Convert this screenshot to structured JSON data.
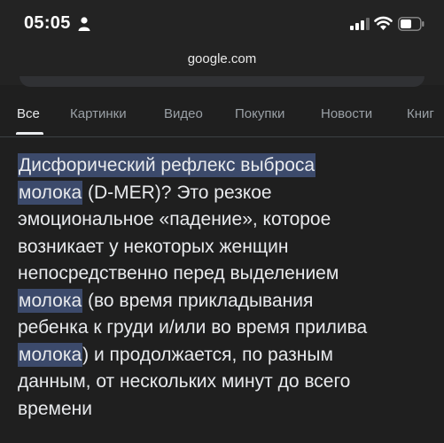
{
  "status_bar": {
    "time": "05:05"
  },
  "browser": {
    "url": "google.com"
  },
  "tabs": [
    {
      "label": "Все",
      "active": true
    },
    {
      "label": "Картинки",
      "active": false
    },
    {
      "label": "Видео",
      "active": false
    },
    {
      "label": "Покупки",
      "active": false
    },
    {
      "label": "Новости",
      "active": false
    },
    {
      "label": "Книг",
      "active": false
    }
  ],
  "result": {
    "l1_hl": "Дисфорический рефлекс выброса",
    "l2_hl": "молока",
    "l2_rest": " (D-MER)? Это резкое",
    "l3": "эмоциональное «падение», которое",
    "l4": "возникает у некоторых женщин",
    "l5": "непосредственно перед выделением",
    "l6_hl": "молока",
    "l6_rest": " (во время прикладывания",
    "l7": "ребенка к груди и/или во время прилива",
    "l8_hl": "молока",
    "l8_rest": ") и продолжается, по разным",
    "l9": "данным, от нескольких минут до всего",
    "l10": "времени"
  },
  "colors": {
    "background": "#1f1f1f",
    "highlight": "#3c4a6b",
    "text": "#e8eaed",
    "tab_inactive": "#9aa0a6"
  }
}
